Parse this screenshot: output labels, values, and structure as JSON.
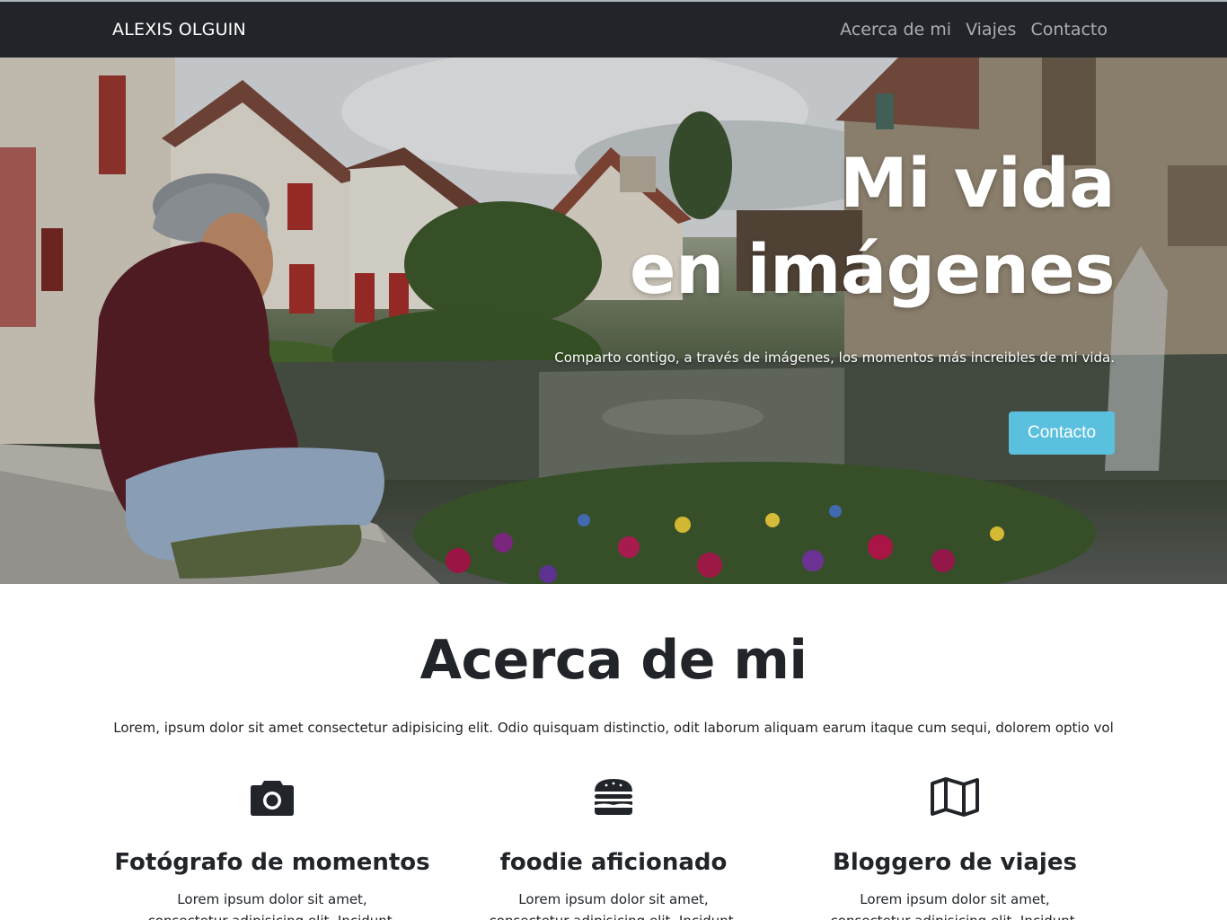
{
  "navbar": {
    "brand": "ALEXIS OLGUIN",
    "links": [
      {
        "label": "Acerca de mi"
      },
      {
        "label": "Viajes"
      },
      {
        "label": "Contacto"
      }
    ]
  },
  "hero": {
    "title_line1": "Mi vida",
    "title_line2": "en imágenes",
    "subtitle": "Comparto contigo, a través de imágenes, los momentos más increibles de mi vida.",
    "button_label": "Contacto"
  },
  "about": {
    "title": "Acerca de mi",
    "lead": "Lorem, ipsum dolor sit amet consectetur adipisicing elit. Odio quisquam distinctio, odit laborum aliquam earum itaque cum sequi, dolorem optio vol",
    "features": [
      {
        "icon": "camera-icon",
        "title": "Fotógrafo de momentos",
        "text": "Lorem ipsum dolor sit amet, consectetur adipisicing elit. Incidunt, placeat."
      },
      {
        "icon": "hamburger-icon",
        "title": "foodie aficionado",
        "text": "Lorem ipsum dolor sit amet, consectetur adipisicing elit. Incidunt, placeat."
      },
      {
        "icon": "map-icon",
        "title": "Bloggero de viajes",
        "text": "Lorem ipsum dolor sit amet, consectetur adipisicing elit. Incidunt, placeat."
      }
    ]
  },
  "colors": {
    "navbar_bg": "#212529",
    "accent_button": "#5bc0de",
    "text_dark": "#212529"
  }
}
